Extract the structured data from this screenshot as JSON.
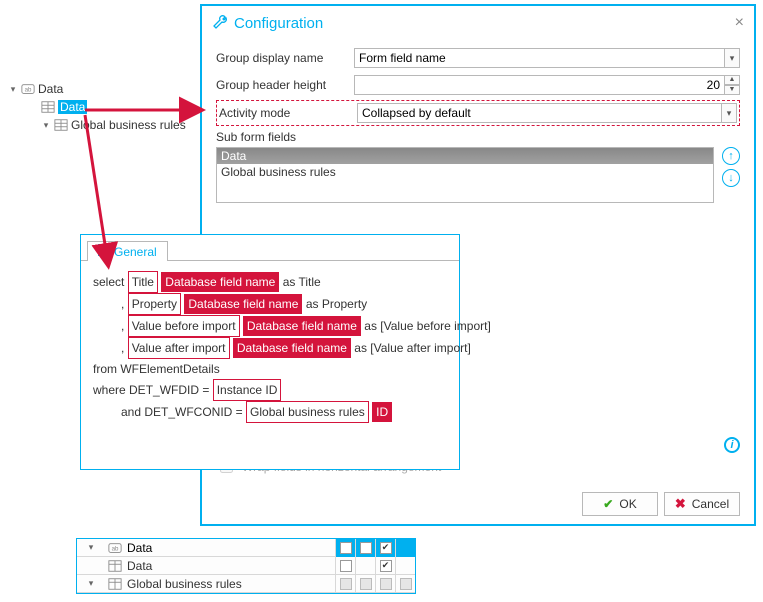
{
  "tree": {
    "root": "Data",
    "items": [
      "Data",
      "Global business rules"
    ]
  },
  "dialog": {
    "title": "Configuration",
    "rows": {
      "group_display_name_label": "Group display name",
      "group_display_name_value": "Form field name",
      "group_header_height_label": "Group header height",
      "group_header_height_value": "20",
      "activity_mode_label": "Activity mode",
      "activity_mode_value": "Collapsed by default"
    },
    "subform_label": "Sub form fields",
    "subform_items": [
      "Data",
      "Global business rules"
    ],
    "wrap_label": "Wrap fields in horizontal arrangement",
    "ok": "OK",
    "cancel": "Cancel"
  },
  "general": {
    "tab": "General",
    "sql": {
      "l1_a": "select",
      "l1_b": "Title",
      "l1_c": "Database field name",
      "l1_d": "as Title",
      "l2_a": ",",
      "l2_b": "Property",
      "l2_c": "Database field name",
      "l2_d": "as Property",
      "l3_a": ",",
      "l3_b": "Value before import",
      "l3_c": "Database field name",
      "l3_d": "as [Value before import]",
      "l4_a": ",",
      "l4_b": "Value after import",
      "l4_c": "Database field name",
      "l4_d": "as [Value after import]",
      "l5": "from WFElementDetails",
      "l6_a": "where DET_WFDID =",
      "l6_b": "Instance ID",
      "l7_a": "and DET_WFCONID =",
      "l7_b": "Global business rules",
      "l7_c": "ID"
    }
  },
  "grid": {
    "rows": [
      {
        "name": "Data",
        "icon": "abc",
        "indent": 0,
        "cells": [
          false,
          false,
          true,
          null
        ]
      },
      {
        "name": "Data",
        "icon": "table",
        "indent": 1,
        "cells": [
          false,
          null,
          true,
          null
        ]
      },
      {
        "name": "Global business rules",
        "icon": "table",
        "indent": 1,
        "cells": [
          "g",
          "g",
          "g",
          "g"
        ]
      }
    ]
  }
}
